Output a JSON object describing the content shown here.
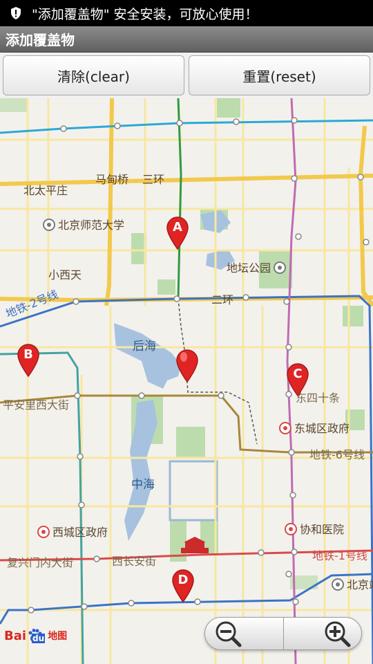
{
  "status": {
    "toast_text": "\"添加覆盖物\" 安全安装，可放心使用！",
    "icon": "shield-icon"
  },
  "app": {
    "title": "添加覆盖物"
  },
  "buttons": {
    "clear_label": "清除(clear)",
    "reset_label": "重置(reset)"
  },
  "map": {
    "labels": {
      "madianqiao": "马甸桥",
      "sanhuan_top": "三环",
      "beitaipingzhuang": "北太平庄",
      "bnu": "北京师范大学",
      "xiaoxitian": "小西天",
      "ditan": "地坛公园",
      "erhuan": "二环",
      "line2": "地铁-2号线",
      "houhai": "后海",
      "pinganli": "平安里西大街",
      "dongsi": "东四十条",
      "dongcheng": "东城区政府",
      "line6": "地铁-6号线",
      "zhonghai": "中海",
      "xicheng": "西城区政府",
      "xiehe": "协和医院",
      "fuxingmen": "复兴门内大街",
      "xichangan": "西长安街",
      "line1": "地铁-1号线",
      "beijing_station": "北京站"
    },
    "markers": {
      "a": "A",
      "b": "B",
      "c": "C",
      "d": "D"
    },
    "logo": {
      "bai": "Bai",
      "du": "du",
      "ditu": "地图"
    },
    "colors": {
      "ring_road": "#f2c94c",
      "line2": "#3b73c4",
      "line6": "#a8873a",
      "line1": "#d94a4a",
      "line4": "#43a3a0",
      "line5": "#c06ab3",
      "line13": "#2aa9d6",
      "water": "#a7c2de",
      "park": "#bcdcae",
      "marker": "#e02424"
    }
  },
  "zoom": {
    "out_icon": "zoom-out-icon",
    "in_icon": "zoom-in-icon"
  }
}
